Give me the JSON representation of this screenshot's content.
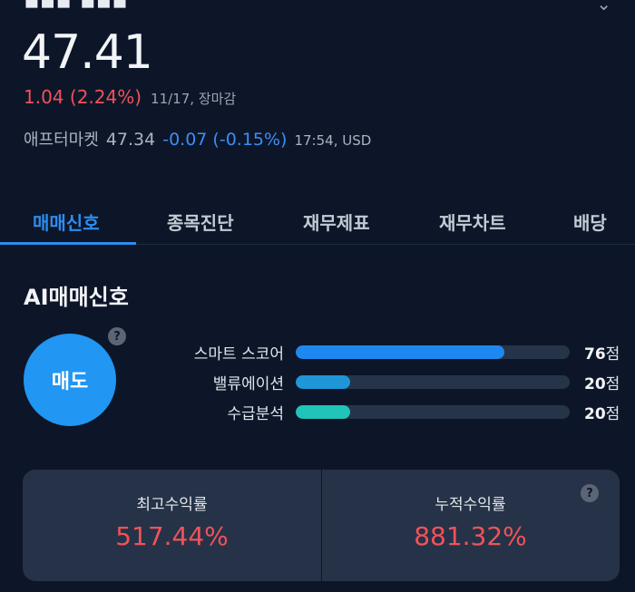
{
  "header": {
    "price": "47.41",
    "change": "1.04 (2.24%)",
    "change_meta": "11/17, 장마감",
    "after_label": "애프터마켓",
    "after_price": "47.34",
    "after_change": "-0.07 (-0.15%)",
    "after_meta": "17:54, USD"
  },
  "tabs": [
    {
      "label": "매매신호",
      "active": true
    },
    {
      "label": "종목진단",
      "active": false
    },
    {
      "label": "재무제표",
      "active": false
    },
    {
      "label": "재무차트",
      "active": false
    },
    {
      "label": "배당",
      "active": false
    }
  ],
  "ai_signal": {
    "title": "AI매매신호",
    "signal": "매도",
    "help": "?",
    "metrics": [
      {
        "label": "스마트 스코어",
        "score": "76",
        "unit": "점",
        "fill_percent": 76,
        "color": "#1e88f0"
      },
      {
        "label": "밸류에이션",
        "score": "20",
        "unit": "점",
        "fill_percent": 20,
        "color": "#1e96d8"
      },
      {
        "label": "수급분석",
        "score": "20",
        "unit": "점",
        "fill_percent": 20,
        "color": "#20c4b8"
      }
    ]
  },
  "returns": {
    "max_label": "최고수익률",
    "max_value": "517.44%",
    "cum_label": "누적수익률",
    "cum_value": "881.32%",
    "help": "?"
  },
  "colors": {
    "accent": "#2d8cf0",
    "up": "#f0525a",
    "down": "#3d8df5",
    "background": "#0d1628"
  }
}
